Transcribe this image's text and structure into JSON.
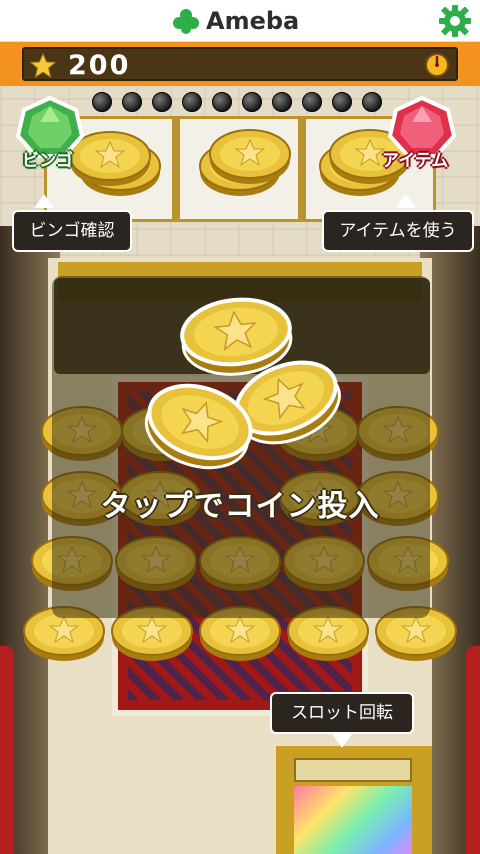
{
  "header": {
    "brand_name": "Ameba",
    "brand_logo_icon": "ameba-logo-icon",
    "settings_icon": "gear-icon",
    "brand_color": "#2eae48"
  },
  "coin_bar": {
    "icon": "star-icon",
    "coin_count": "200",
    "timer_icon": "timer-icon"
  },
  "machine": {
    "lamps_count_shown": 11,
    "bingo_button": {
      "label": "ビンゴ",
      "icon": "green-gem-icon",
      "color": "#3cb04a"
    },
    "item_button": {
      "label": "アイテム",
      "icon": "red-gem-icon",
      "color": "#e0304a"
    },
    "tap_prompt": "タップでコイン投入"
  },
  "tooltips": {
    "bingo_check": "ビンゴ確認",
    "use_item": "アイテムを使う",
    "slot_spin": "スロット回転"
  }
}
